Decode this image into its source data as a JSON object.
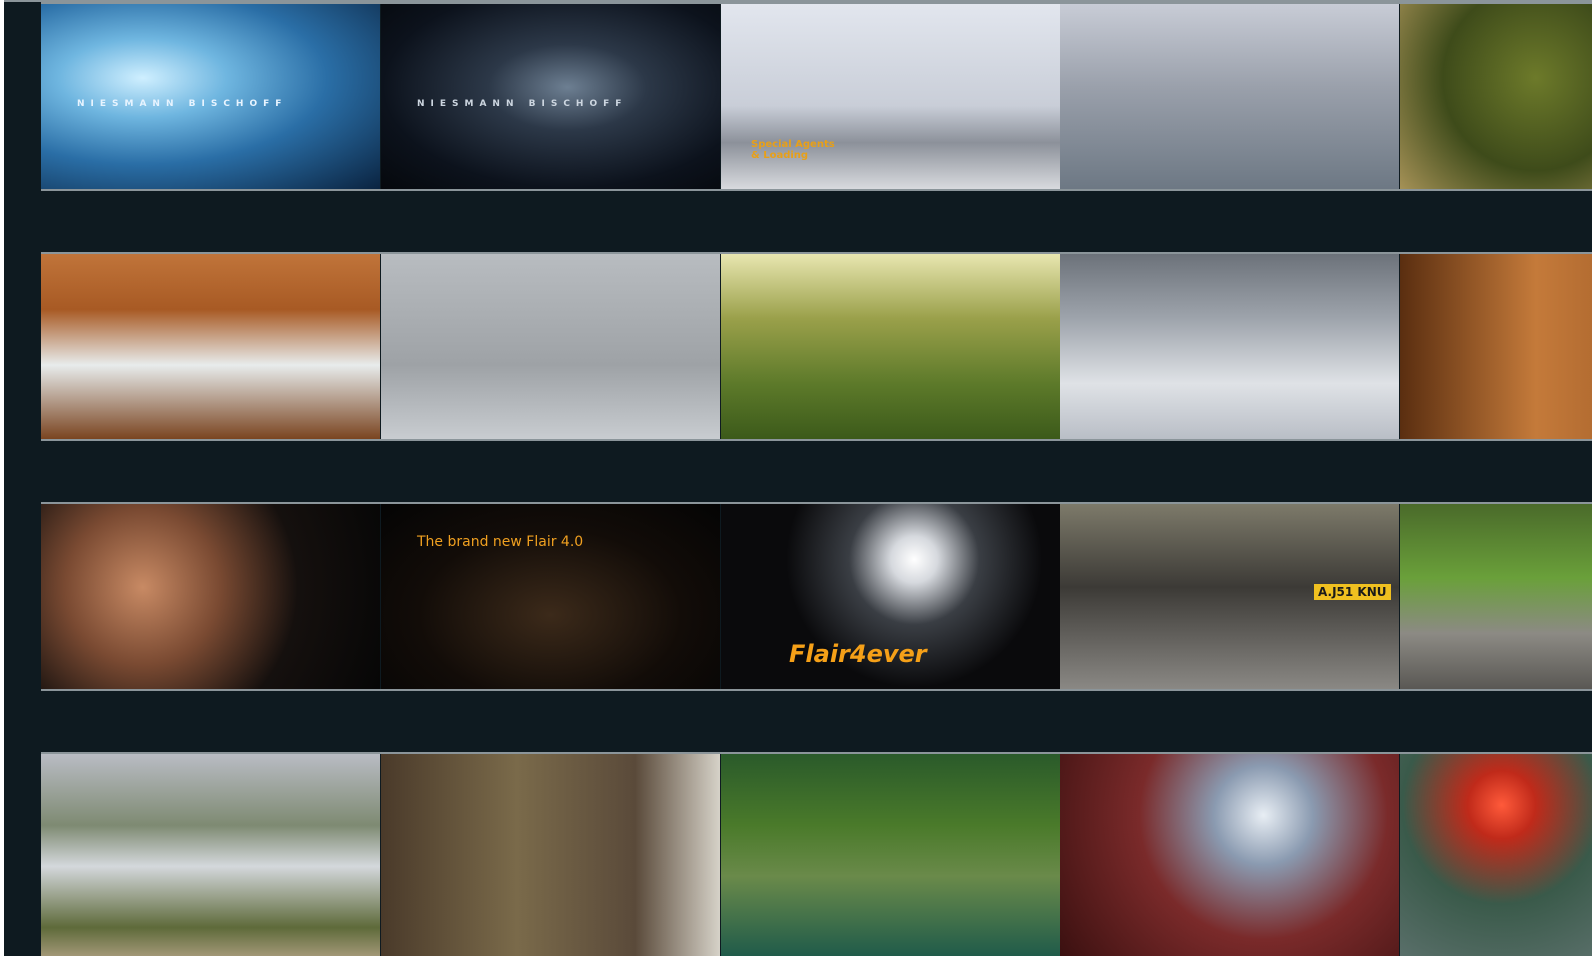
{
  "rows": [
    {
      "tiles": [
        {
          "name": "tile-crystal-logo",
          "text": "NIESMANN BISCHOFF",
          "bg": "radial-gradient(ellipse at 30% 40%, #cfefff 0%, #6fb6e0 25%, #2a6ea6 55%, #0a2340 100%)"
        },
        {
          "name": "tile-dark-logo",
          "text": "NIESMANN BISCHOFF",
          "bg": "radial-gradient(ellipse at 55% 45%, #6d7f92 0%, #2c3848 30%, #0c121c 70%, #05080c 100%)"
        },
        {
          "name": "tile-building-agents",
          "text": "Special Agents\n& Loading",
          "bg": "linear-gradient(180deg,#e2e6ee 0%, #c9ced8 55%, #8c919a 75%, #d8dade 100%)"
        },
        {
          "name": "tile-two-men",
          "text": "",
          "bg": "linear-gradient(180deg,#c8ccd6 0%, #9aa0ab 45%, #6d7884 100%)"
        },
        {
          "name": "tile-blur-green",
          "text": "",
          "bg": "radial-gradient(circle at 40% 40%, #6d7a2a 0%, #3e4b1a 40%, #b29a5e 80%)"
        }
      ]
    },
    {
      "tiles": [
        {
          "name": "tile-interior-bed",
          "text": "",
          "bg": "linear-gradient(180deg,#c0743a 0%, #a85a24 30%, #e8ecec 60%, #7a4420 100%)"
        },
        {
          "name": "tile-concrete-room",
          "text": "",
          "bg": "linear-gradient(180deg,#b8bcc0 0%, #9ea2a6 60%, #c8ccd0 100%)"
        },
        {
          "name": "tile-park-people",
          "text": "",
          "bg": "linear-gradient(180deg,#e8e6b0 0%, #9aa04a 35%, #5d7a2a 70%, #3c5a1a 100%)"
        },
        {
          "name": "tile-drawing-hand",
          "text": "",
          "bg": "linear-gradient(180deg,#6c727a 0%, #9ea4ac 35%, #dfe2e6 70%, #b9bec6 100%)"
        },
        {
          "name": "tile-wood-cabinet",
          "text": "",
          "bg": "linear-gradient(90deg,#5a2e10 0%, #c47a3a 40%, #8a4a1c 100%)"
        }
      ]
    },
    {
      "tiles": [
        {
          "name": "tile-woman-face",
          "text": "",
          "bg": "radial-gradient(circle at 30% 45%, #c88a64 0%, #7a4a32 30%, #15100e 60%, #060606 100%)"
        },
        {
          "name": "tile-fire-dancers",
          "text": "The brand new Flair 4.0",
          "bg": "radial-gradient(ellipse at 50% 60%, #3c2a1a 0%, #120c08 55%, #040404 100%)"
        },
        {
          "name": "tile-gunbarrel",
          "text": "Flair4ever",
          "bg": "radial-gradient(circle at 57% 30%, #ffffff 0%, #d6d9de 10%, #3a3e44 28%, #0a0a0c 55%)"
        },
        {
          "name": "tile-car-headlight",
          "text": "A.J51 KNU",
          "bg": "linear-gradient(180deg,#7d7a6a 0%, #3c3a36 45%, #8a8884 100%)"
        },
        {
          "name": "tile-mountain-climber",
          "text": "",
          "bg": "linear-gradient(180deg,#4a6a2a 0%, #6aa03a 40%, #8c8a84 70%, #5a5854 100%)"
        }
      ]
    },
    {
      "tiles": [
        {
          "name": "tile-motorhome",
          "text": "",
          "bg": "linear-gradient(180deg,#b9bcc4 0%, #7e8a72 35%, #d4d8dc 55%, #5e6a3a 85%, #a69a7a 100%)"
        },
        {
          "name": "tile-martial-arts",
          "text": "",
          "bg": "linear-gradient(90deg,#4a3a2a 0%, #7a6a4a 40%, #5a4a3a 75%, #d6d2c8 100%)"
        },
        {
          "name": "tile-lake-yoga",
          "text": "",
          "bg": "linear-gradient(180deg,#2a5a2a 0%, #4a7a2a 35%, #6a8a4a 60%, #1e5a4a 100%)"
        },
        {
          "name": "tile-cocktail",
          "text": "",
          "bg": "radial-gradient(circle at 60% 30%, #e8eef4 0%, #8a9ab0 20%, #7a2a2a 50%, #3a1010 100%)"
        },
        {
          "name": "tile-red-lantern",
          "text": "",
          "bg": "radial-gradient(circle at 30% 25%, #ff5a3a 0%, #c02a1a 12%, #3a5a4a 35%, #6a7a7a 80%)"
        }
      ]
    }
  ]
}
